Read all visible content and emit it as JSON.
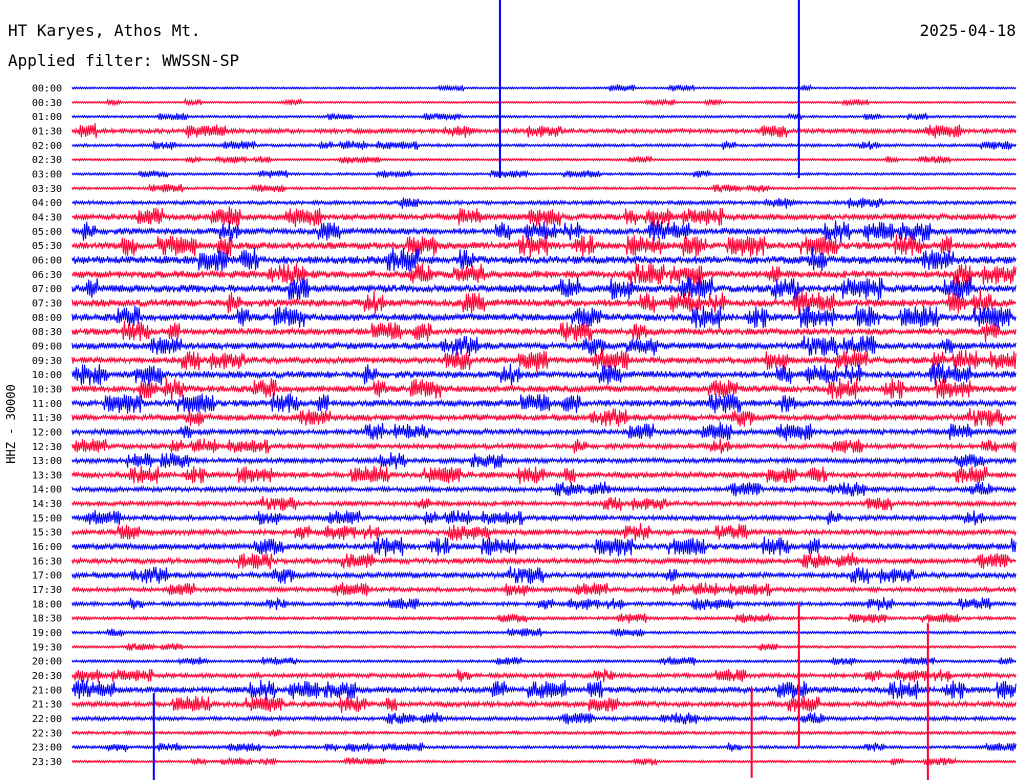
{
  "chart_data": {
    "type": "line",
    "title": "HT Karyes, Athos Mt.",
    "subtitle": "Applied filter: WWSSN-SP",
    "date": "2025-04-18",
    "ylabel": "HHZ - 30000",
    "xlabel": "",
    "row_labels": [
      "00:00",
      "00:30",
      "01:00",
      "01:30",
      "02:00",
      "02:30",
      "03:00",
      "03:30",
      "04:00",
      "04:30",
      "05:00",
      "05:30",
      "06:00",
      "06:30",
      "07:00",
      "07:30",
      "08:00",
      "08:30",
      "09:00",
      "09:30",
      "10:00",
      "10:30",
      "11:00",
      "11:30",
      "12:00",
      "12:30",
      "13:00",
      "13:30",
      "14:00",
      "14:30",
      "15:00",
      "15:30",
      "16:00",
      "16:30",
      "17:00",
      "17:30",
      "18:00",
      "18:30",
      "19:00",
      "19:30",
      "20:00",
      "20:30",
      "21:00",
      "21:30",
      "22:00",
      "22:30",
      "23:00",
      "23:30"
    ],
    "series_colors": [
      "#0000ff",
      "#ff0033"
    ],
    "activity_level": [
      0.08,
      0.06,
      0.12,
      0.35,
      0.18,
      0.1,
      0.12,
      0.14,
      0.28,
      0.55,
      0.6,
      0.65,
      0.75,
      0.7,
      0.72,
      0.7,
      0.68,
      0.6,
      0.62,
      0.6,
      0.65,
      0.62,
      0.6,
      0.55,
      0.5,
      0.4,
      0.42,
      0.5,
      0.4,
      0.38,
      0.4,
      0.45,
      0.55,
      0.45,
      0.5,
      0.35,
      0.3,
      0.2,
      0.15,
      0.12,
      0.15,
      0.35,
      0.55,
      0.45,
      0.3,
      0.2,
      0.18,
      0.12
    ],
    "events": [
      {
        "time": "00:00",
        "minute": 23.1,
        "peak": 1.0
      },
      {
        "time": "20:30",
        "minute": 23.1,
        "peak": 0.8
      },
      {
        "time": "21:30",
        "minute": 27.2,
        "peak": 0.9
      },
      {
        "time": "00:00",
        "minute": 13.6,
        "peak": 1.0
      },
      {
        "time": "23:00",
        "minute": 2.6,
        "peak": 0.6
      },
      {
        "time": "22:30",
        "minute": 21.6,
        "peak": 0.5
      }
    ]
  }
}
